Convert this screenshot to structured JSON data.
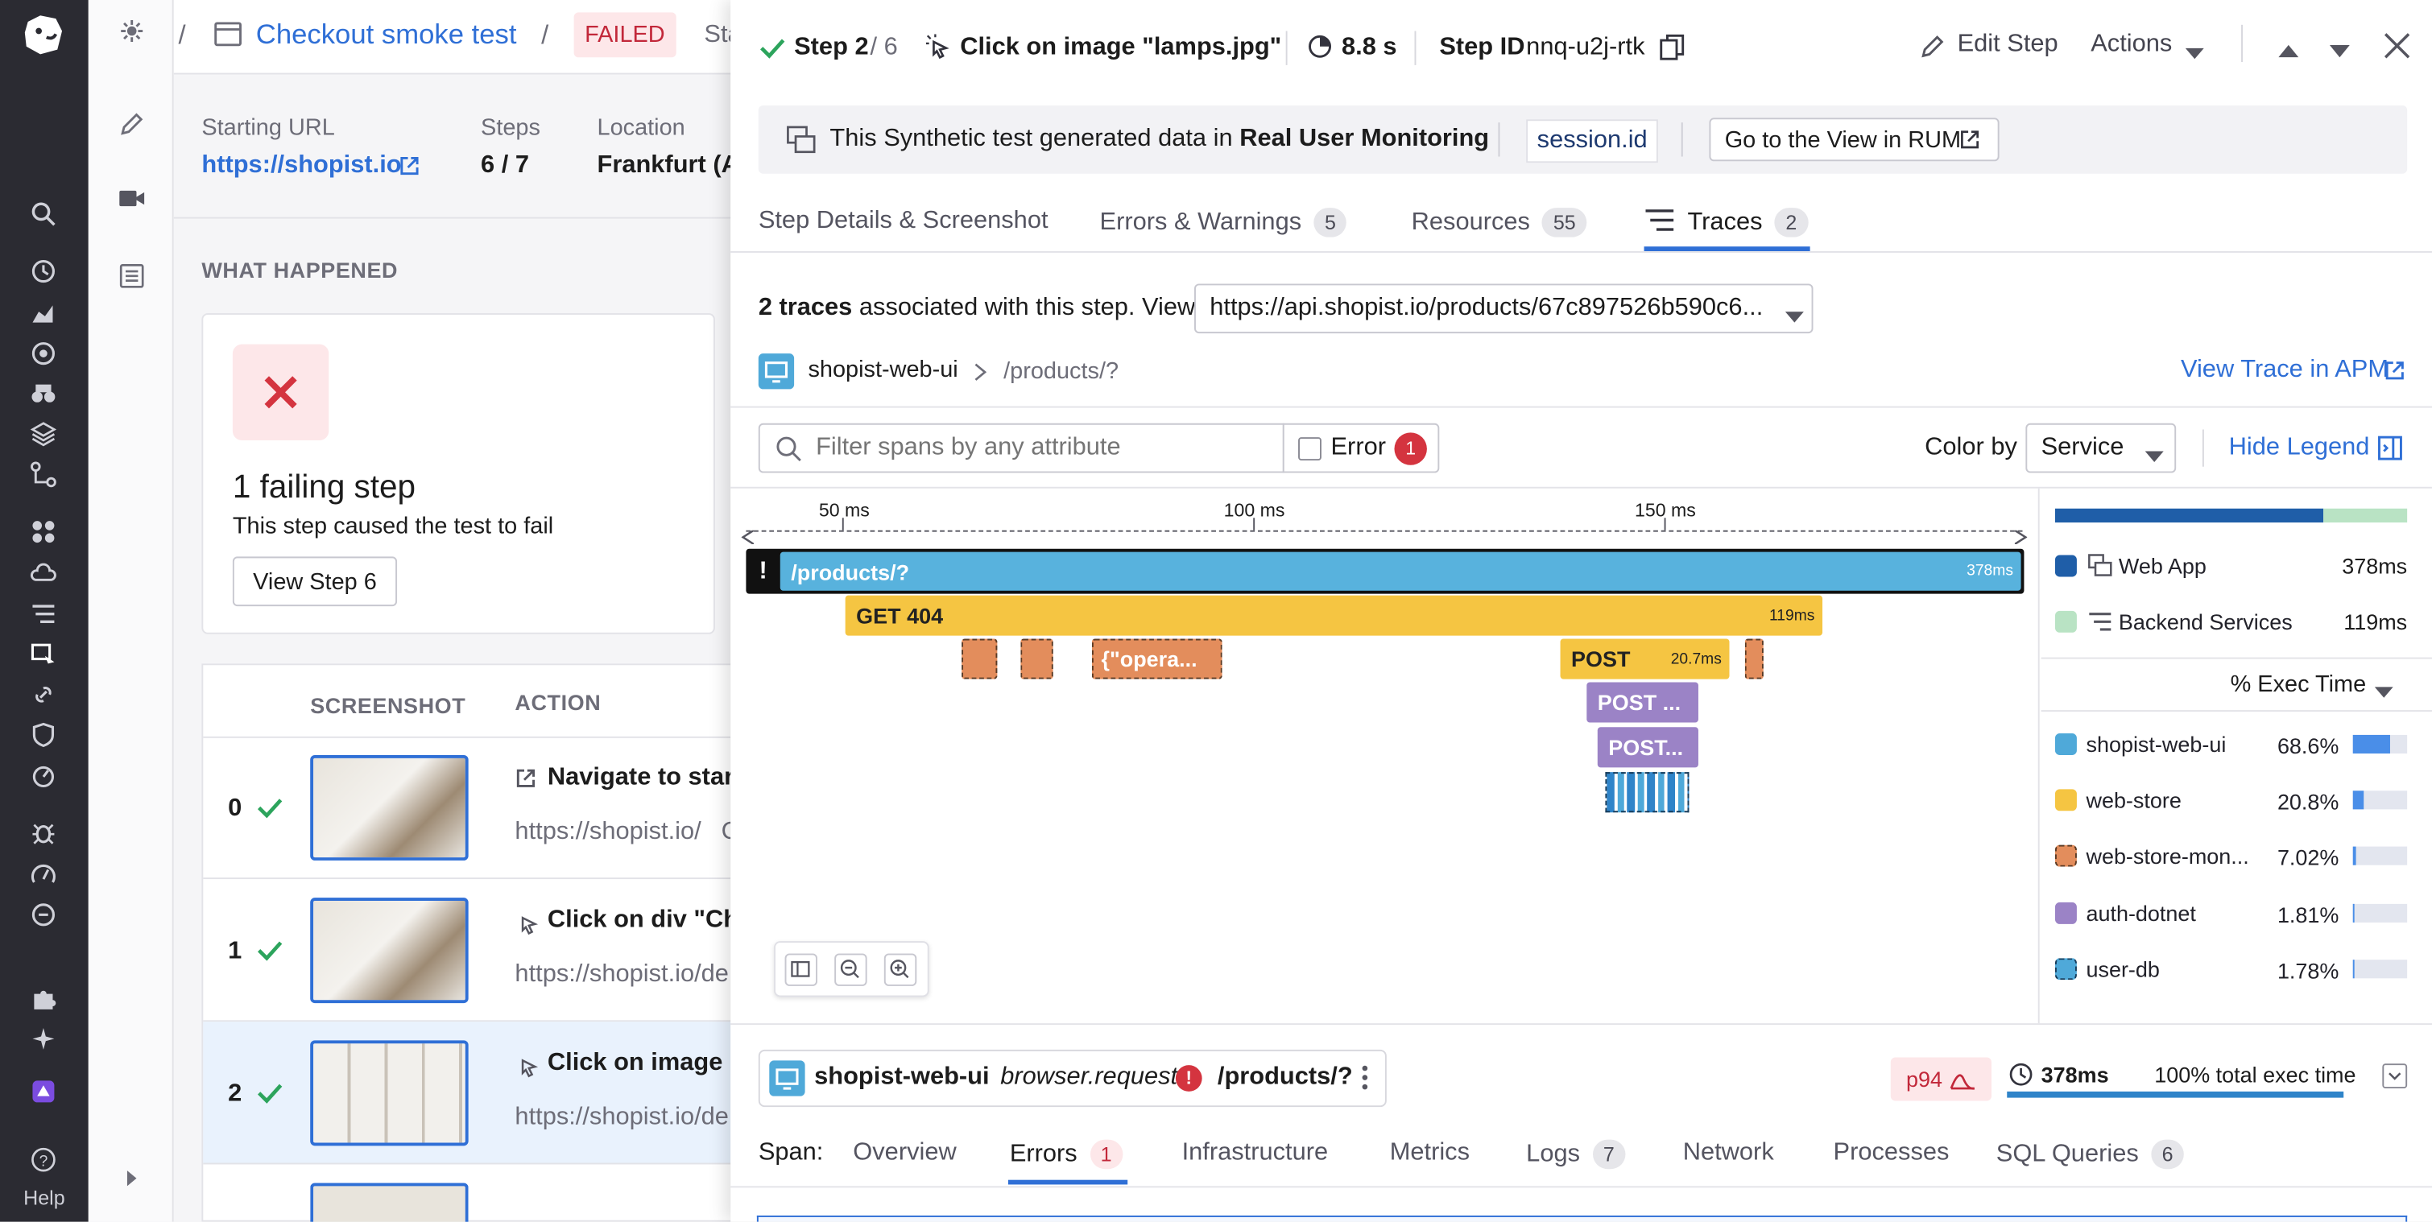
{
  "leftnav": {
    "help_label": "Help"
  },
  "breadcrumb": {
    "sep1": "/",
    "test_name": "Checkout smoke test",
    "sep2": "/",
    "status": "FAILED",
    "tail": "Sta"
  },
  "summary": {
    "starting_url_label": "Starting URL",
    "starting_url": "https://shopist.io",
    "steps_label": "Steps",
    "steps_value": "6 / 7",
    "location_label": "Location",
    "location_value": "Frankfurt (A"
  },
  "what_happened": {
    "title": "WHAT HAPPENED",
    "failing_title": "1 failing step",
    "failing_desc": "This step caused the test to fail",
    "view_step_button": "View Step 6"
  },
  "steps_table": {
    "headers": [
      "SCREENSHOT",
      "ACTION"
    ],
    "rows": [
      {
        "index": "0",
        "action": "Navigate to star",
        "url": "https://shopist.io/",
        "url_tail": "C"
      },
      {
        "index": "1",
        "action": "Click on div \"Cha",
        "url": "https://shopist.io/de"
      },
      {
        "index": "2",
        "action": "Click on image \"",
        "url": "https://shopist.io/de"
      }
    ]
  },
  "panel_header": {
    "step_label": "Step 2",
    "step_total": "/ 6",
    "action": "Click on image \"lamps.jpg\"",
    "duration": "8.8 s",
    "step_id_label": "Step ID",
    "step_id": "nnq-u2j-rtk",
    "edit_step": "Edit Step",
    "actions": "Actions"
  },
  "rum_banner": {
    "text_prefix": "This Synthetic test generated data in",
    "text_bold": "Real User Monitoring",
    "session_id": "session.id",
    "rum_button": "Go to the View in RUM"
  },
  "tabs": [
    {
      "label": "Step Details & Screenshot",
      "count": ""
    },
    {
      "label": "Errors & Warnings",
      "count": "5"
    },
    {
      "label": "Resources",
      "count": "55"
    },
    {
      "label": "Traces",
      "count": "2"
    }
  ],
  "traces": {
    "count_bold": "2 traces",
    "count_text": "associated with this step. View",
    "selected_url": "https://api.shopist.io/products/67c897526b590c6...",
    "service": "shopist-web-ui",
    "path": "/products/?",
    "view_apm": "View Trace in APM",
    "filter_placeholder": "Filter spans by any attribute",
    "error_label": "Error",
    "error_count": "1",
    "color_by_label": "Color by",
    "color_by_value": "Service",
    "hide_legend": "Hide Legend",
    "timeline_ticks": [
      "50 ms",
      "100 ms",
      "150 ms"
    ]
  },
  "spans": {
    "root": {
      "label": "/products/?",
      "duration": "378ms"
    },
    "get": {
      "label": "GET 404",
      "duration": "119ms"
    },
    "opera": {
      "label": "{\"opera..."
    },
    "post": {
      "label": "POST",
      "duration": "20.7ms"
    },
    "post2": {
      "label": "POST ..."
    },
    "post3": {
      "label": "POST..."
    }
  },
  "legend": {
    "groups": [
      {
        "name": "Web App",
        "value": "378ms",
        "color": "#1f5ea8"
      },
      {
        "name": "Backend Services",
        "value": "119ms",
        "color": "#b9e3c4"
      }
    ],
    "sort_label": "% Exec Time",
    "services": [
      {
        "name": "shopist-web-ui",
        "pct": "68.6%",
        "fill": 0.686,
        "color": "#4fa9d9"
      },
      {
        "name": "web-store",
        "pct": "20.8%",
        "fill": 0.208,
        "color": "#f5c542"
      },
      {
        "name": "web-store-mon...",
        "pct": "7.02%",
        "fill": 0.0702,
        "color": "#e38d5c"
      },
      {
        "name": "auth-dotnet",
        "pct": "1.81%",
        "fill": 0.0181,
        "color": "#9b83c6"
      },
      {
        "name": "user-db",
        "pct": "1.78%",
        "fill": 0.0178,
        "color": "#4fa9d9"
      }
    ]
  },
  "span_detail": {
    "service": "shopist-web-ui",
    "operation": "browser.request",
    "resource": "/products/?",
    "p94": "p94",
    "duration": "378ms",
    "exec_time": "100% total exec time",
    "span_label": "Span:",
    "tabs": [
      {
        "label": "Overview",
        "count": ""
      },
      {
        "label": "Errors",
        "count": "1"
      },
      {
        "label": "Infrastructure",
        "count": ""
      },
      {
        "label": "Metrics",
        "count": ""
      },
      {
        "label": "Logs",
        "count": "7"
      },
      {
        "label": "Network",
        "count": ""
      },
      {
        "label": "Processes",
        "count": ""
      },
      {
        "label": "SQL Queries",
        "count": "6"
      }
    ]
  }
}
